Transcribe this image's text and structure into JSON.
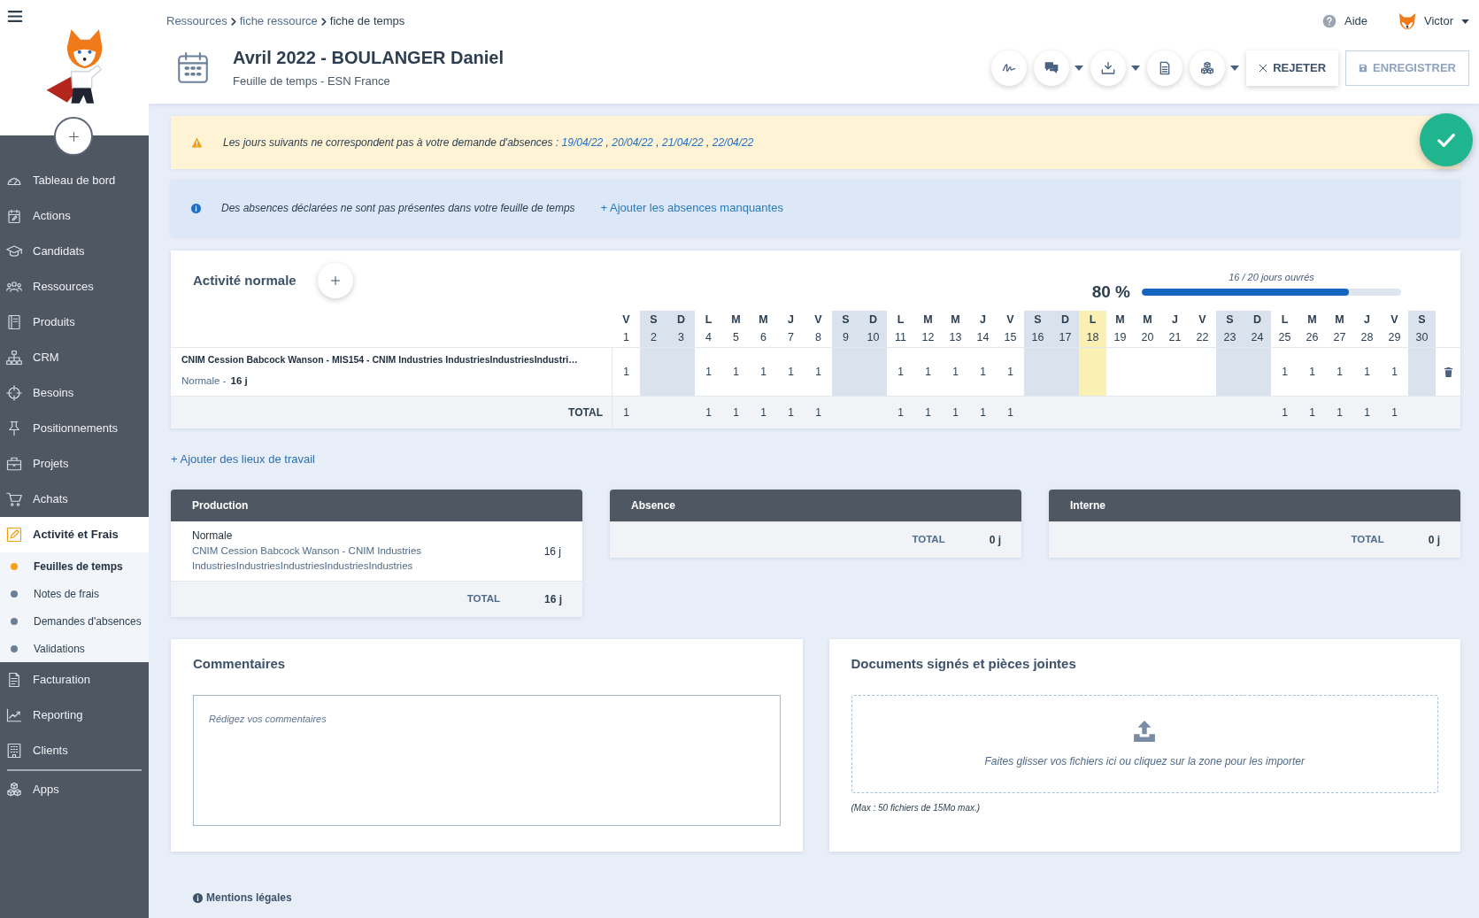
{
  "sidebar": {
    "items": [
      {
        "label": "Tableau de bord",
        "selected": false
      },
      {
        "label": "Actions",
        "selected": false
      },
      {
        "label": "Candidats",
        "selected": false
      },
      {
        "label": "Ressources",
        "selected": false
      },
      {
        "label": "Produits",
        "selected": false
      },
      {
        "label": "CRM",
        "selected": false
      },
      {
        "label": "Besoins",
        "selected": false
      },
      {
        "label": "Positionnements",
        "selected": false
      },
      {
        "label": "Projets",
        "selected": false
      },
      {
        "label": "Achats",
        "selected": false
      },
      {
        "label": "Activité et Frais",
        "selected": true,
        "children": [
          {
            "label": "Feuilles de temps",
            "selected": true
          },
          {
            "label": "Notes de frais",
            "selected": false
          },
          {
            "label": "Demandes d'absences",
            "selected": false
          },
          {
            "label": "Validations",
            "selected": false
          }
        ]
      },
      {
        "label": "Facturation",
        "selected": false
      },
      {
        "label": "Reporting",
        "selected": false
      },
      {
        "label": "Clients",
        "selected": false
      }
    ],
    "extra_items": [
      {
        "label": "Apps",
        "selected": false
      }
    ]
  },
  "header": {
    "breadcrumb": [
      {
        "label": "Ressources",
        "current": false
      },
      {
        "label": "fiche ressource",
        "current": false
      },
      {
        "label": "fiche de temps",
        "current": true
      }
    ],
    "title": "Avril 2022 - BOULANGER Daniel",
    "subtitle": "Feuille de temps - ESN France",
    "help": "Aide",
    "user": "Victor",
    "tools": [
      {
        "dropdown": false
      },
      {
        "dropdown": true
      },
      {
        "dropdown": true
      },
      {
        "dropdown": false
      },
      {
        "dropdown": true
      }
    ],
    "actions": [
      {
        "label": "REJETER",
        "disabled": false
      },
      {
        "label": "ENREGISTRER",
        "disabled": true
      }
    ]
  },
  "alerts": [
    {
      "kind": "warning",
      "text": "Les jours suivants ne correspondent pas à votre demande d'absences :",
      "dates": [
        "19/04/22",
        "20/04/22",
        "21/04/22",
        "22/04/22"
      ],
      "separator": ","
    },
    {
      "kind": "info",
      "text": "Des absences déclarées ne sont pas présentes dans votre feuille de temps",
      "action": "+ Ajouter les absences manquantes"
    }
  ],
  "activity": {
    "title": "Activité normale",
    "percent": "80 %",
    "progress": {
      "label": "16 / 20 jours ouvrés",
      "level": 0.8
    },
    "rows": [
      {
        "project": "CNIM Cession Babcock Wanson - MIS154 - CNIM Industries IndustriesIndustriesIndustri…",
        "type": "Normale -",
        "total": "16 j"
      }
    ],
    "total_label": "TOTAL",
    "days": [
      {
        "letter": "V",
        "number": "1",
        "weekend": false,
        "highlighted": false,
        "cells": [
          "1"
        ],
        "total": "1"
      },
      {
        "letter": "S",
        "number": "2",
        "weekend": true,
        "highlighted": false
      },
      {
        "letter": "D",
        "number": "3",
        "weekend": true,
        "highlighted": false
      },
      {
        "letter": "L",
        "number": "4",
        "weekend": false,
        "highlighted": false,
        "cells": [
          "1"
        ],
        "total": "1"
      },
      {
        "letter": "M",
        "number": "5",
        "weekend": false,
        "highlighted": false,
        "cells": [
          "1"
        ],
        "total": "1"
      },
      {
        "letter": "M",
        "number": "6",
        "weekend": false,
        "highlighted": false,
        "cells": [
          "1"
        ],
        "total": "1"
      },
      {
        "letter": "J",
        "number": "7",
        "weekend": false,
        "highlighted": false,
        "cells": [
          "1"
        ],
        "total": "1"
      },
      {
        "letter": "V",
        "number": "8",
        "weekend": false,
        "highlighted": false,
        "cells": [
          "1"
        ],
        "total": "1"
      },
      {
        "letter": "S",
        "number": "9",
        "weekend": true,
        "highlighted": false
      },
      {
        "letter": "D",
        "number": "10",
        "weekend": true,
        "highlighted": false
      },
      {
        "letter": "L",
        "number": "11",
        "weekend": false,
        "highlighted": false,
        "cells": [
          "1"
        ],
        "total": "1"
      },
      {
        "letter": "M",
        "number": "12",
        "weekend": false,
        "highlighted": false,
        "cells": [
          "1"
        ],
        "total": "1"
      },
      {
        "letter": "M",
        "number": "13",
        "weekend": false,
        "highlighted": false,
        "cells": [
          "1"
        ],
        "total": "1"
      },
      {
        "letter": "J",
        "number": "14",
        "weekend": false,
        "highlighted": false,
        "cells": [
          "1"
        ],
        "total": "1"
      },
      {
        "letter": "V",
        "number": "15",
        "weekend": false,
        "highlighted": false,
        "cells": [
          "1"
        ],
        "total": "1"
      },
      {
        "letter": "S",
        "number": "16",
        "weekend": true,
        "highlighted": false
      },
      {
        "letter": "D",
        "number": "17",
        "weekend": true,
        "highlighted": false
      },
      {
        "letter": "L",
        "number": "18",
        "weekend": false,
        "highlighted": true
      },
      {
        "letter": "M",
        "number": "19",
        "weekend": false,
        "highlighted": false
      },
      {
        "letter": "M",
        "number": "20",
        "weekend": false,
        "highlighted": false
      },
      {
        "letter": "J",
        "number": "21",
        "weekend": false,
        "highlighted": false
      },
      {
        "letter": "V",
        "number": "22",
        "weekend": false,
        "highlighted": false
      },
      {
        "letter": "S",
        "number": "23",
        "weekend": true,
        "highlighted": false
      },
      {
        "letter": "D",
        "number": "24",
        "weekend": true,
        "highlighted": false
      },
      {
        "letter": "L",
        "number": "25",
        "weekend": false,
        "highlighted": false,
        "cells": [
          "1"
        ],
        "total": "1"
      },
      {
        "letter": "M",
        "number": "26",
        "weekend": false,
        "highlighted": false,
        "cells": [
          "1"
        ],
        "total": "1"
      },
      {
        "letter": "M",
        "number": "27",
        "weekend": false,
        "highlighted": false,
        "cells": [
          "1"
        ],
        "total": "1"
      },
      {
        "letter": "J",
        "number": "28",
        "weekend": false,
        "highlighted": false,
        "cells": [
          "1"
        ],
        "total": "1"
      },
      {
        "letter": "V",
        "number": "29",
        "weekend": false,
        "highlighted": false,
        "cells": [
          "1"
        ],
        "total": "1"
      },
      {
        "letter": "S",
        "number": "30",
        "weekend": true,
        "highlighted": false
      }
    ]
  },
  "add_location": "+ Ajouter des lieux de travail",
  "summaries": [
    {
      "title": "Production",
      "lines": [
        {
          "type": "Normale",
          "detail": "CNIM Cession Babcock Wanson - CNIM Industries IndustriesIndustriesIndustriesIndustriesIndustries",
          "value": "16 j"
        }
      ],
      "total_label": "TOTAL",
      "total": "16 j"
    },
    {
      "title": "Absence",
      "total_label": "TOTAL",
      "total": "0 j"
    },
    {
      "title": "Interne",
      "total_label": "TOTAL",
      "total": "0 j"
    }
  ],
  "comments": {
    "title": "Commentaires",
    "placeholder": "Rédigez vos commentaires"
  },
  "documents": {
    "title": "Documents signés et pièces jointes",
    "dropzone": "Faites glisser vos fichiers ici ou cliquez sur la zone pour les importer",
    "note": "(Max : 50 fichiers de 15Mo max.)"
  },
  "footer": {
    "legal": "Mentions légales"
  }
}
